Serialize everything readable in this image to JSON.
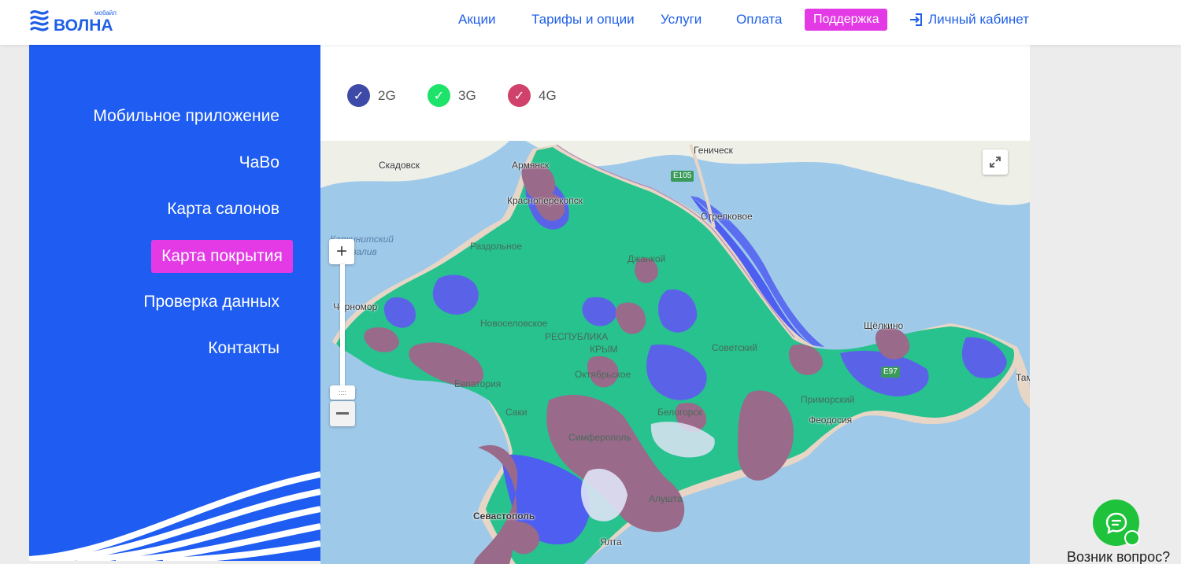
{
  "brand": {
    "name": "ВОЛНА",
    "tagline": "мобайл",
    "color": "#1f5fe6"
  },
  "nav": {
    "items": [
      "Акции",
      "Тарифы и опции",
      "Услуги",
      "Оплата"
    ],
    "support": "Поддержка",
    "login": "Личный кабинет"
  },
  "sidebar": {
    "items": [
      "Мобильное приложение",
      "ЧаВо",
      "Карта салонов",
      "Проверка данных",
      "Контакты"
    ],
    "active": "Карта покрытия"
  },
  "legend": [
    {
      "label": "2G",
      "color": "#3e4aa8",
      "checked": true
    },
    {
      "label": "3G",
      "color": "#1ee36a",
      "checked": true
    },
    {
      "label": "4G",
      "color": "#d0426a",
      "checked": true
    }
  ],
  "map": {
    "places": {
      "skadovsk": "Скадовск",
      "armyansk": "Армянск",
      "krasnoperekopsk": "Красноперекопск",
      "genichesk": "Геническ",
      "strelkovoe": "Стрелковое",
      "karkinit": "Каркинитский",
      "zaliv": "залив",
      "razdolnoe": "Раздольное",
      "dzhankoy": "Джанкой",
      "chernomorskoe": "Черномор",
      "novoselovskoe": "Новоселовское",
      "respublika": "РЕСПУБЛИКА",
      "krym": "КРЫМ",
      "sovetskiy": "Советский",
      "shchelkino": "Щёлкино",
      "oktyabrskoe": "Октябрьское",
      "evpatoriya": "Евпатория",
      "primorskiy": "Приморский",
      "belogorsk": "Белогорск",
      "feodosiya": "Феодосия",
      "simferopol": "Симферополь",
      "sevastopol": "Севастополь",
      "alushta": "Алушта",
      "yalta": "Ялта",
      "saki": "Саки",
      "tam": "Там",
      "e105": "E105",
      "e97": "E97"
    },
    "zoom_in": "+",
    "zoom_handle": "::::"
  },
  "chat": {
    "label": "Возник вопрос?"
  }
}
